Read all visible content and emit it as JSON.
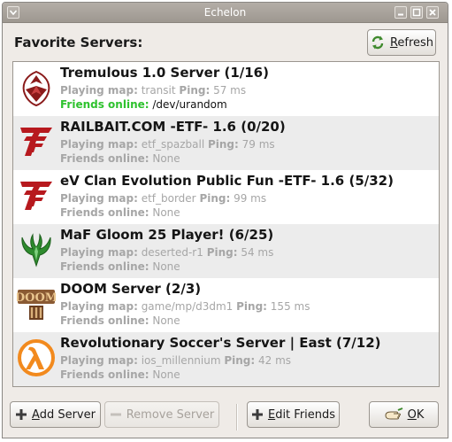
{
  "window": {
    "title": "Echelon"
  },
  "header": {
    "label": "Favorite Servers:",
    "refresh_prefix": "",
    "refresh_underline": "R",
    "refresh_rest": "efresh"
  },
  "labels": {
    "playing_map": "Playing map:",
    "ping": "Ping:",
    "friends_online": "Friends online:"
  },
  "servers": [
    {
      "name": "Tremulous 1.0 Server (1/16)",
      "icon": "tremulous-icon",
      "map": "transit",
      "ping": "57 ms",
      "friends": "/dev/urandom",
      "friends_highlight": true
    },
    {
      "name": "RAILBAIT.COM -ETF- 1.6 (0/20)",
      "icon": "etf-icon",
      "map": "etf_spazball",
      "ping": "79 ms",
      "friends": "None",
      "friends_highlight": false
    },
    {
      "name": "eV Clan Evolution Public Fun -ETF- 1.6 (5/32)",
      "icon": "etf-icon",
      "map": "etf_border",
      "ping": "99 ms",
      "friends": "None",
      "friends_highlight": false
    },
    {
      "name": "MaF Gloom 25 Player! (6/25)",
      "icon": "quake-icon",
      "map": "deserted-r1",
      "ping": "54 ms",
      "friends": "None",
      "friends_highlight": false
    },
    {
      "name": "DOOM Server (2/3)",
      "icon": "doom-icon",
      "map": "game/mp/d3dm1",
      "ping": "155 ms",
      "friends": "None",
      "friends_highlight": false
    },
    {
      "name": "Revolutionary Soccer's Server | East (7/12)",
      "icon": "half-life-icon",
      "map": "ios_millennium",
      "ping": "42 ms",
      "friends": "None",
      "friends_highlight": false
    }
  ],
  "buttons": {
    "add_server": {
      "u": "A",
      "rest": "dd Server"
    },
    "remove_server": {
      "u": "",
      "rest": "Remove Server"
    },
    "edit_friends": {
      "u": "E",
      "rest": "dit Friends"
    },
    "ok": {
      "u": "O",
      "rest": "K"
    }
  },
  "colors": {
    "friends_online": "#2ec22e",
    "etf_red": "#b7191e",
    "quake_green": "#2e8b2e",
    "halflife_orange": "#f28a1e",
    "doom_brown": "#7a4a2a"
  }
}
